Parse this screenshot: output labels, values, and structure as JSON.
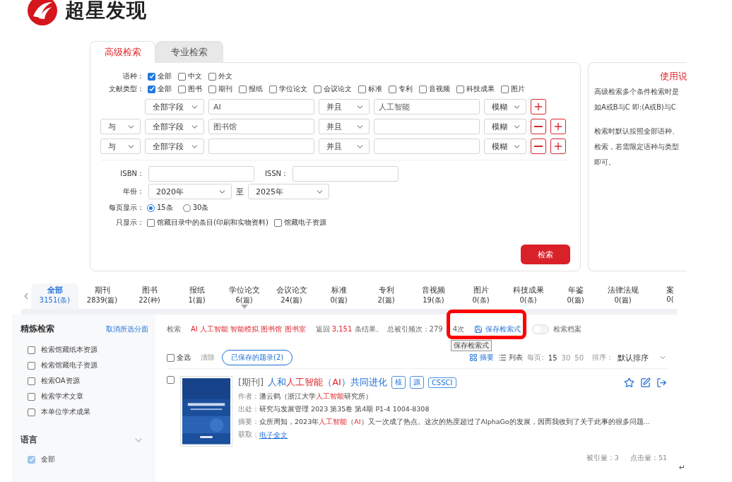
{
  "logo": {
    "text": "超星发现"
  },
  "search_tabs": [
    {
      "label": "高级检索",
      "selected": true
    },
    {
      "label": "专业检索",
      "selected": false
    }
  ],
  "language": {
    "label": "语种：",
    "options": [
      {
        "label": "全部",
        "checked": true
      },
      {
        "label": "中文",
        "checked": false
      },
      {
        "label": "外文",
        "checked": false
      }
    ]
  },
  "doc_type": {
    "label": "文献类型：",
    "options": [
      {
        "label": "全部",
        "checked": true
      },
      {
        "label": "图书",
        "checked": false
      },
      {
        "label": "期刊",
        "checked": false
      },
      {
        "label": "报纸",
        "checked": false
      },
      {
        "label": "学位论文",
        "checked": false
      },
      {
        "label": "会议论文",
        "checked": false
      },
      {
        "label": "标准",
        "checked": false
      },
      {
        "label": "专利",
        "checked": false
      },
      {
        "label": "音视频",
        "checked": false
      },
      {
        "label": "科技成果",
        "checked": false
      },
      {
        "label": "图片",
        "checked": false
      }
    ]
  },
  "conditions": [
    {
      "field": "全部字段",
      "term": "AI",
      "operator": "并且",
      "term2": "人工智能",
      "match": "模糊",
      "removable": false
    },
    {
      "logic": "与",
      "field": "全部字段",
      "term": "图书馆",
      "operator": "并且",
      "match": "模糊",
      "removable": true
    },
    {
      "logic": "与",
      "field": "全部字段",
      "operator": "并且",
      "match": "模糊",
      "removable": true
    }
  ],
  "isbn": {
    "label": "ISBN："
  },
  "issn": {
    "label": "ISSN："
  },
  "year": {
    "label": "年份：",
    "from": "2020年",
    "separator": "至",
    "to": "2025年"
  },
  "per_page": {
    "label": "每页显示：",
    "options": [
      {
        "label": "15条",
        "selected": true
      },
      {
        "label": "30条",
        "selected": false
      }
    ]
  },
  "only_show": {
    "label": "只显示：",
    "options": [
      {
        "label": "馆藏目录中的条目(印刷和实物资料)",
        "checked": false
      },
      {
        "label": "馆藏电子资源",
        "checked": false
      }
    ]
  },
  "search_button": "检索",
  "help": {
    "title": "使用说",
    "paragraphs": [
      [
        "高级检索多个条件检索时是",
        "如A或B与C 即:(A或B)与C"
      ],
      [
        "检索时默认按照全部语种、",
        "检索，若需限定语种与类型",
        "即可。"
      ]
    ]
  },
  "categories": [
    {
      "label": "全部",
      "count": "3151(条)",
      "selected": true,
      "has_menu": false
    },
    {
      "label": "期刊",
      "count": "2839(篇)",
      "selected": false,
      "has_menu": false
    },
    {
      "label": "图书",
      "count": "22(种)",
      "selected": false,
      "has_menu": false
    },
    {
      "label": "报纸",
      "count": "1(篇)",
      "selected": false,
      "has_menu": false
    },
    {
      "label": "学位论文",
      "count": "6(篇)",
      "selected": false,
      "has_menu": true
    },
    {
      "label": "会议论文",
      "count": "24(篇)",
      "selected": false,
      "has_menu": false
    },
    {
      "label": "标准",
      "count": "0(篇)",
      "selected": false,
      "has_menu": false
    },
    {
      "label": "专利",
      "count": "2(篇)",
      "selected": false,
      "has_menu": false
    },
    {
      "label": "音视频",
      "count": "19(条)",
      "selected": false,
      "has_menu": false
    },
    {
      "label": "图片",
      "count": "0(条)",
      "selected": false,
      "has_menu": false
    },
    {
      "label": "科技成果",
      "count": "0(条)",
      "selected": false,
      "has_menu": false
    },
    {
      "label": "年鉴",
      "count": "0(篇)",
      "selected": false,
      "has_menu": false
    },
    {
      "label": "法律法规",
      "count": "0(篇)",
      "selected": false,
      "has_menu": false
    },
    {
      "label": "案",
      "count": "0(",
      "selected": false,
      "has_menu": false
    }
  ],
  "refine": {
    "title": "精炼检索",
    "clear": "取消所选分面",
    "options": [
      {
        "label": "检索馆藏纸本资源",
        "checked": false
      },
      {
        "label": "检索馆藏电子资源",
        "checked": false
      },
      {
        "label": "检索OA资源",
        "checked": false
      },
      {
        "label": "检索学术文章",
        "checked": false
      },
      {
        "label": "本单位学术成果",
        "checked": false
      }
    ],
    "section": {
      "title": "语言",
      "expanded": false,
      "options": [
        {
          "label": "全部",
          "checked": true
        }
      ]
    }
  },
  "summary": {
    "prefix": "检索",
    "terms": "AI 人工智能 智能模拟 图书馆 图书室",
    "returned": "返回",
    "total": "3,151",
    "suffix": "条结果。",
    "citations": "总被引频次：279",
    "citations_tail": "4次",
    "save": "保存检索式",
    "archive": "检索档案",
    "archive_on": false,
    "tooltip": "保存检索式"
  },
  "toolbar": {
    "select_all": "全选",
    "select_all_checked": false,
    "clear": "清除",
    "saved": "已保存的题录(2)",
    "views": [
      {
        "label": "摘要",
        "selected": true
      },
      {
        "label": "列表",
        "selected": false
      }
    ],
    "per_page_label": "每页:",
    "per_page": [
      {
        "label": "15",
        "selected": true
      },
      {
        "label": "30",
        "selected": false
      },
      {
        "label": "50",
        "selected": false
      }
    ],
    "sort_label": "排序：",
    "sort": "默认排序"
  },
  "results": [
    {
      "checked": false,
      "type": "[期刊]",
      "title": [
        {
          "text": "人和",
          "hit": false
        },
        {
          "text": "人工智能",
          "hit": true
        },
        {
          "text": "（",
          "hit": false
        },
        {
          "text": "AI",
          "hit": true
        },
        {
          "text": "）共同进化",
          "hit": false
        }
      ],
      "tags": [
        "核",
        "源",
        "CSSCI"
      ],
      "author_label": "作者：",
      "author": [
        {
          "text": "潘云鹤（浙江大学",
          "hit": false
        },
        {
          "text": "人工智能",
          "hit": true
        },
        {
          "text": "研究所）",
          "hit": false
        }
      ],
      "source_label": "出处：",
      "source": "研究与发展管理 2023 第35卷 第4期 P1-4  1004-8308",
      "abstract_label": "摘要：",
      "abstract": [
        {
          "text": "众所周知，2023年",
          "hit": false
        },
        {
          "text": "人工智能",
          "hit": true
        },
        {
          "text": "（",
          "hit": false
        },
        {
          "text": "AI",
          "hit": true
        },
        {
          "text": "）又一次成了热点。这次的热度超过了AlphaGo的发展，因而我收到了关于此事的很多问题...",
          "hit": false
        }
      ],
      "access_label": "获取：",
      "access": "电子全文",
      "cited": "被引量：3",
      "clicks": "点击量：51"
    }
  ],
  "return_mark": "↵"
}
